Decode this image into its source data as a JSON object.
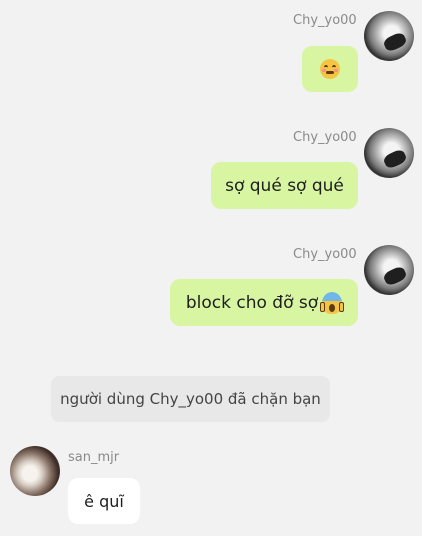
{
  "messages": [
    {
      "sender": "Chy_yo00",
      "text": "",
      "emoji": "shy-face-emoji"
    },
    {
      "sender": "Chy_yo00",
      "text": "sợ qué sợ qué"
    },
    {
      "sender": "Chy_yo00",
      "text": "block cho đỡ sợ",
      "emoji": "screaming-face-emoji"
    }
  ],
  "system_notice": "người dùng Chy_yo00 đã chặn bạn",
  "incoming": {
    "sender": "san_mjr",
    "text": "ê quĩ"
  },
  "colors": {
    "outgoing_bubble": "#d8f5a2",
    "incoming_bubble": "#ffffff",
    "background": "#f2f2f2",
    "system_bubble": "#e8e8e8"
  }
}
